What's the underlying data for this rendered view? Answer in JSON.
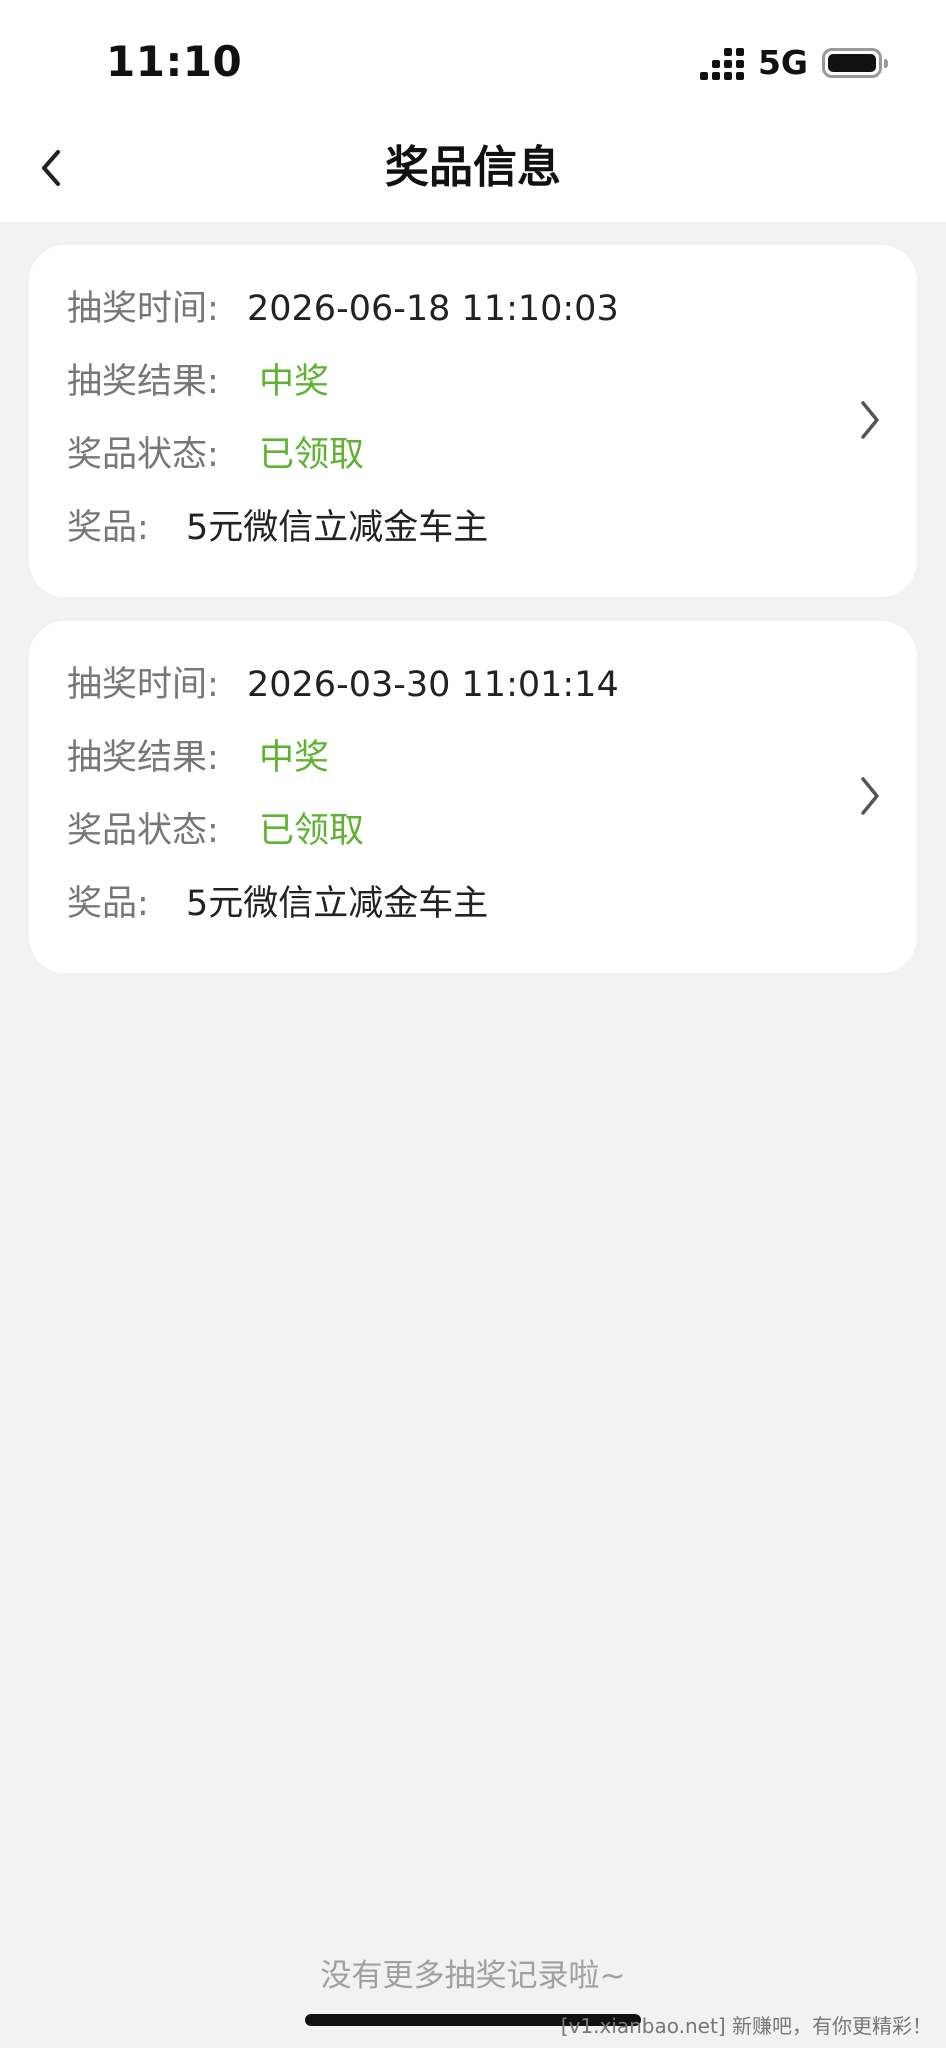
{
  "status_bar": {
    "time": "11:10",
    "network": "5G",
    "icons": [
      "signal-icon",
      "battery-icon"
    ]
  },
  "nav": {
    "title": "奖品信息",
    "back_icon": "chevron-left-icon"
  },
  "records": [
    {
      "time_label": "抽奖时间:",
      "time_value": "2026-06-18 11:10:03",
      "result_label": "抽奖结果:",
      "result_value": "中奖",
      "status_label": "奖品状态:",
      "status_value": "已领取",
      "prize_label": "奖品:",
      "prize_value": "5元微信立减金车主"
    },
    {
      "time_label": "抽奖时间:",
      "time_value": "2026-03-30 11:01:14",
      "result_label": "抽奖结果:",
      "result_value": "中奖",
      "status_label": "奖品状态:",
      "status_value": "已领取",
      "prize_label": "奖品:",
      "prize_value": "5元微信立减金车主"
    }
  ],
  "footer": {
    "no_more_text": "没有更多抽奖记录啦~"
  },
  "watermark": {
    "text": "[v1.xianbao.net] 新赚吧，有你更精彩！"
  },
  "colors": {
    "accent_green": "#5fb232",
    "page_bg": "#f2f2f2",
    "card_bg": "#ffffff"
  }
}
